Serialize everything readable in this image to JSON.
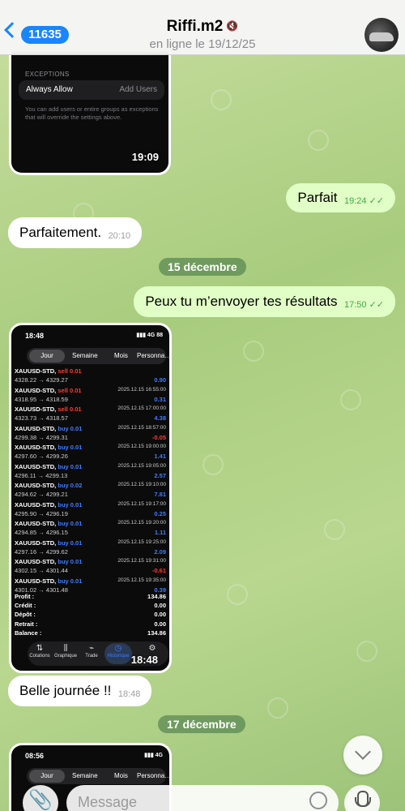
{
  "header": {
    "back_count": "11635",
    "title": "Riffi.m2",
    "status": "en ligne le 19/12/25"
  },
  "messages": {
    "shot1": {
      "section_label": "EXCEPTIONS",
      "row_label": "Always Allow",
      "row_action": "Add Users",
      "note": "You can add users or entire groups as exceptions that will override the settings above.",
      "time": "19:09"
    },
    "m1": {
      "text": "Parfait",
      "time": "19:24"
    },
    "m2": {
      "text": "Parfaitement.",
      "time": "20:10"
    },
    "date1": "15 décembre",
    "m3": {
      "text": "Peux tu m’envoyer tes résultats",
      "time": "17:50"
    },
    "shot2": {
      "status_time": "18:48",
      "network": "4G",
      "battery": "88",
      "tabs": [
        "Jour",
        "Semaine",
        "Mois",
        "Personna…"
      ],
      "trades": [
        {
          "asset": "XAUUSD-STD,",
          "side": "sell 0.01",
          "prices": "4328.22 → 4329.27",
          "date": "",
          "profit": "0.90",
          "neg": false
        },
        {
          "asset": "XAUUSD-STD,",
          "side": "sell 0.01",
          "prices": "4318.95 → 4318.59",
          "date": "2025.12.15 16:55:00",
          "profit": "0.31",
          "neg": false
        },
        {
          "asset": "XAUUSD-STD,",
          "side": "sell 0.01",
          "prices": "4323.73 → 4318.57",
          "date": "2025.12.15 17:00:00",
          "profit": "4.38",
          "neg": false
        },
        {
          "asset": "XAUUSD-STD,",
          "side": "buy 0.01",
          "prices": "4299.38 → 4299.31",
          "date": "2025.12.15 18:57:00",
          "profit": "-0.05",
          "neg": true
        },
        {
          "asset": "XAUUSD-STD,",
          "side": "buy 0.01",
          "prices": "4297.60 → 4299.26",
          "date": "2025.12.15 19:00:00",
          "profit": "1.41",
          "neg": false
        },
        {
          "asset": "XAUUSD-STD,",
          "side": "buy 0.01",
          "prices": "4296.11 → 4299.13",
          "date": "2025.12.15 19:05:00",
          "profit": "2.57",
          "neg": false
        },
        {
          "asset": "XAUUSD-STD,",
          "side": "buy 0.02",
          "prices": "4294.62 → 4299.21",
          "date": "2025.12.15 19:10:00",
          "profit": "7.81",
          "neg": false
        },
        {
          "asset": "XAUUSD-STD,",
          "side": "buy 0.01",
          "prices": "4295.90 → 4296.19",
          "date": "2025.12.15 19:17:00",
          "profit": "0.25",
          "neg": false
        },
        {
          "asset": "XAUUSD-STD,",
          "side": "buy 0.01",
          "prices": "4294.85 → 4296.15",
          "date": "2025.12.15 19:20:00",
          "profit": "1.11",
          "neg": false
        },
        {
          "asset": "XAUUSD-STD,",
          "side": "buy 0.01",
          "prices": "4297.16 → 4299.62",
          "date": "2025.12.15 19:25:00",
          "profit": "2.09",
          "neg": false
        },
        {
          "asset": "XAUUSD-STD,",
          "side": "buy 0.01",
          "prices": "4302.15 → 4301.44",
          "date": "2025.12.15 19:31:00",
          "profit": "-0.61",
          "neg": true
        },
        {
          "asset": "XAUUSD-STD,",
          "side": "buy 0.01",
          "prices": "4301.02 → 4301.48",
          "date": "2025.12.15 19:35:00",
          "profit": "0.39",
          "neg": false
        }
      ],
      "summary": [
        {
          "k": "Profit :",
          "v": "134.86"
        },
        {
          "k": "Crédit :",
          "v": "0.00"
        },
        {
          "k": "Dépôt :",
          "v": "0.00"
        },
        {
          "k": "Retrait :",
          "v": "0.00"
        },
        {
          "k": "Balance :",
          "v": "134.86"
        }
      ],
      "nav": [
        "Cotations",
        "Graphique",
        "Trade",
        "Historique",
        "Paramètres"
      ],
      "time": "18:48"
    },
    "m4": {
      "text": "Belle journée !!",
      "time": "18:48"
    },
    "date2": "17 décembre",
    "shot3": {
      "status_time": "08:56",
      "network": "4G",
      "tabs": [
        "Jour",
        "Semaine",
        "Mois",
        "Personna…"
      ]
    }
  },
  "composer": {
    "placeholder": "Message"
  }
}
